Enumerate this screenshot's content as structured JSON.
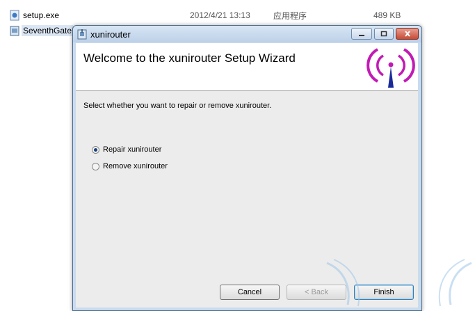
{
  "files": [
    {
      "name": "setup.exe",
      "date": "2012/4/21 13:13",
      "type": "应用程序",
      "size": "489 KB",
      "icon": "setup-exe-icon"
    },
    {
      "name": "SeventhGate",
      "icon": "msi-package-icon"
    }
  ],
  "window": {
    "title": "xunirouter",
    "icon": "installer-icon",
    "minimize_icon": "minimize-icon",
    "maximize_icon": "maximize-icon",
    "close_icon": "close-icon"
  },
  "banner": {
    "title": "Welcome to the xunirouter Setup Wizard",
    "logo": "wireless-antenna-icon"
  },
  "prompt": "Select whether you want to repair or remove xunirouter.",
  "options": [
    {
      "label": "Repair xunirouter",
      "selected": true
    },
    {
      "label": "Remove xunirouter",
      "selected": false
    }
  ],
  "buttons": {
    "cancel": "Cancel",
    "back": "< Back",
    "finish": "Finish"
  },
  "colors": {
    "logo": "#c21ab5",
    "antenna": "#1a2a9a"
  }
}
